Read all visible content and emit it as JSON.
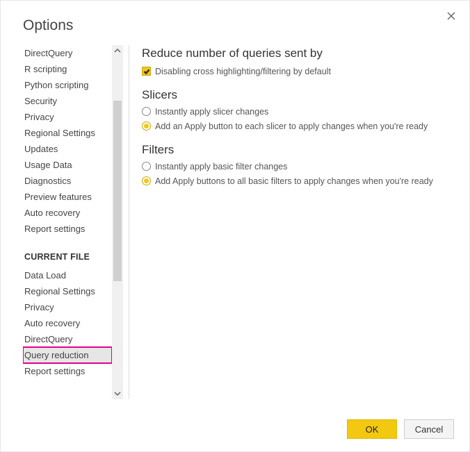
{
  "title": "Options",
  "sidebar": {
    "global": [
      "DirectQuery",
      "R scripting",
      "Python scripting",
      "Security",
      "Privacy",
      "Regional Settings",
      "Updates",
      "Usage Data",
      "Diagnostics",
      "Preview features",
      "Auto recovery",
      "Report settings"
    ],
    "current_header": "CURRENT FILE",
    "current": [
      "Data Load",
      "Regional Settings",
      "Privacy",
      "Auto recovery",
      "DirectQuery",
      "Query reduction",
      "Report settings"
    ],
    "selected": "Query reduction"
  },
  "main": {
    "reduce_title": "Reduce number of queries sent by",
    "reduce_check": "Disabling cross highlighting/filtering by default",
    "slicers_title": "Slicers",
    "slicers_opt_instant": "Instantly apply slicer changes",
    "slicers_opt_apply": "Add an Apply button to each slicer to apply changes when you're ready",
    "filters_title": "Filters",
    "filters_opt_instant": "Instantly apply basic filter changes",
    "filters_opt_apply": "Add Apply buttons to all basic filters to apply changes when you're ready"
  },
  "footer": {
    "ok": "OK",
    "cancel": "Cancel"
  }
}
